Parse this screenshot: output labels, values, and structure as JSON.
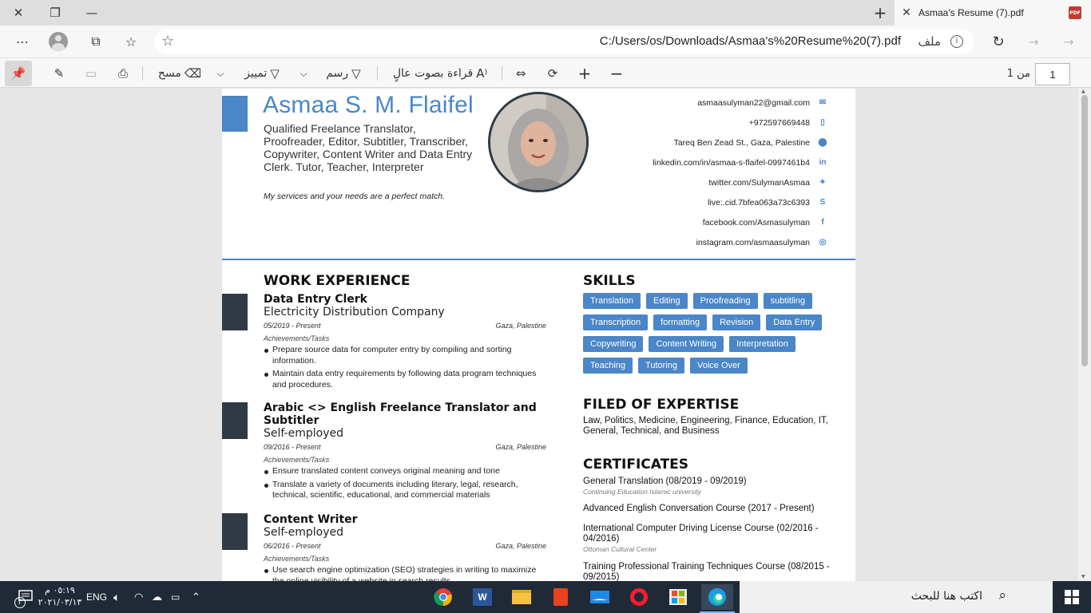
{
  "browser": {
    "tab_title": "Asmaa's Resume (7).pdf",
    "url": "C:/Users/os/Downloads/Asmaa's%20Resume%20(7).pdf",
    "url_scheme_label": "ملف",
    "pdf_icon_label": "PDF"
  },
  "pdf_toolbar": {
    "erase_label": "مسح",
    "highlight_label": "تمييز",
    "draw_label": "رسم",
    "read_aloud_label": "قراءة بصوت عالٍ",
    "page_current": "1",
    "page_of_label": "من 1"
  },
  "resume": {
    "name": "Asmaa S. M. Flaifel",
    "headline": "Qualified Freelance Translator, Proofreader, Editor, Subtitler, Transcriber, Copywriter, Content Writer and Data Entry Clerk. Tutor, Teacher, Interpreter",
    "motto": "My services and your needs are a perfect match.",
    "contacts": [
      {
        "text": "asmaasulyman22@gmail.com",
        "icon": "email-icon",
        "glyph": "✉"
      },
      {
        "text": "+972597669448",
        "icon": "phone-icon",
        "glyph": "▯"
      },
      {
        "text": "Tareq Ben Zead St., Gaza, Palestine",
        "icon": "location-icon",
        "glyph": "⬤"
      },
      {
        "text": "linkedin.com/in/asmaa-s-flaifel-0997461b4",
        "icon": "linkedin-icon",
        "glyph": "in"
      },
      {
        "text": "twitter.com/SulymanAsmaa",
        "icon": "twitter-icon",
        "glyph": "✦"
      },
      {
        "text": "live:.cid.7bfea063a73c6393",
        "icon": "skype-icon",
        "glyph": "S"
      },
      {
        "text": "facebook.com/Asmasulyman",
        "icon": "facebook-icon",
        "glyph": "f"
      },
      {
        "text": "instagram.com/asmaasulyman",
        "icon": "instagram-icon",
        "glyph": "◎"
      }
    ],
    "sections": {
      "work": "WORK EXPERIENCE",
      "skills": "SKILLS",
      "expertise": "FILED OF EXPERTISE",
      "certificates": "CERTIFICATES"
    },
    "jobs": [
      {
        "title": "Data Entry Clerk",
        "company": "Electricity Distribution Company",
        "dates": "05/2019 - Present",
        "location": "Gaza, Palestine",
        "achievements_label": "Achievements/Tasks",
        "tasks": [
          "Prepare source data for computer entry by compiling and sorting information.",
          "Maintain data entry requirements by following data program techniques and procedures."
        ]
      },
      {
        "title": "Arabic <> English Freelance Translator and Subtitler",
        "company": "Self-employed",
        "dates": "09/2016 - Present",
        "location": "Gaza, Palestine",
        "achievements_label": "Achievements/Tasks",
        "tasks": [
          "Ensure translated content conveys original meaning and tone",
          "Translate a variety of documents including literary, legal, research, technical, scientific, educational, and commercial materials"
        ]
      },
      {
        "title": "Content Writer",
        "company": "Self-employed",
        "dates": "06/2016 - Present",
        "location": "Gaza, Palestine",
        "achievements_label": "Achievements/Tasks",
        "tasks": [
          "Use search engine optimization (SEO) strategies in writing to maximize the online visibility of a website in search results"
        ]
      }
    ],
    "skills": [
      "Translation",
      "Editing",
      "Proofreading",
      "subtitling",
      "Transcription",
      "formatting",
      "Revision",
      "Data Entry",
      "Copywriting",
      "Content Writing",
      "Interpretation",
      "Teaching",
      "Tutoring",
      "Voice Over"
    ],
    "expertise": "Law, Politics, Medicine, Engineering, Finance, Education, IT, General, Technical, and Business",
    "certificates": [
      {
        "name": "General Translation (08/2019 - 09/2019)",
        "org": "Continuing Education Islamic university"
      },
      {
        "name": "Advanced English Conversation Course (2017 - Present)",
        "org": ""
      },
      {
        "name": "International Computer Driving License Course (02/2016 - 04/2016)",
        "org": "Ottoman Cultural Center"
      },
      {
        "name": "Training Professional Training Techniques Course (08/2015 - 09/2015)",
        "org": ""
      }
    ]
  },
  "taskbar": {
    "search_placeholder": "اكتب هنا للبحث",
    "time": "٠٥:١٩ م",
    "date": "٢٠٢١/٠٣/١٣",
    "language": "ENG",
    "notification_count": "٣"
  },
  "colors": {
    "accent": "#4a86c8",
    "dark_block": "#2f3a44",
    "taskbar": "#202a36"
  }
}
